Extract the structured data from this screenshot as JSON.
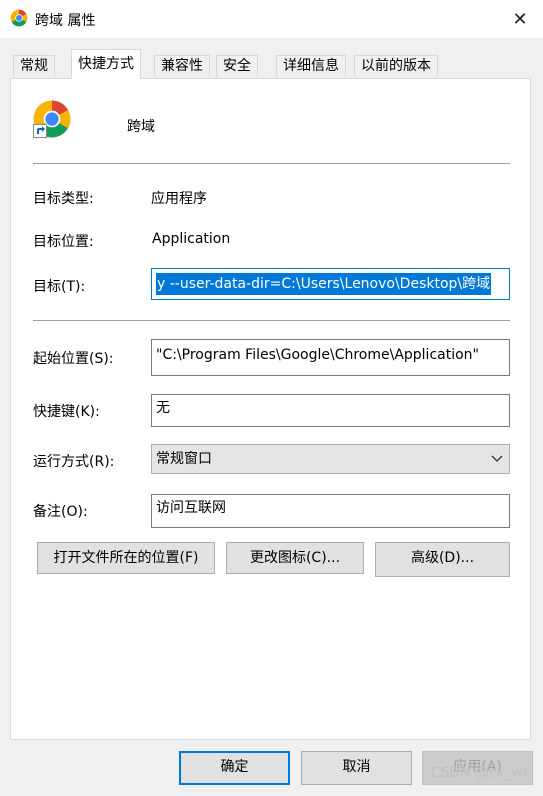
{
  "window": {
    "title": "跨域 属性",
    "close_glyph": "✕"
  },
  "tabs": [
    {
      "label": "常规"
    },
    {
      "label": "快捷方式"
    },
    {
      "label": "兼容性"
    },
    {
      "label": "安全"
    },
    {
      "label": "详细信息"
    },
    {
      "label": "以前的版本"
    }
  ],
  "shortcut": {
    "name": "跨域",
    "target_type_label": "目标类型:",
    "target_type_value": "应用程序",
    "target_location_label": "目标位置:",
    "target_location_value": "Application",
    "target_label": "目标(T):",
    "target_value": "y --user-data-dir=C:\\Users\\Lenovo\\Desktop\\跨域",
    "start_in_label": "起始位置(S):",
    "start_in_value": "\"C:\\Program Files\\Google\\Chrome\\Application\"",
    "hotkey_label": "快捷键(K):",
    "hotkey_value": "无",
    "run_label": "运行方式(R):",
    "run_value": "常规窗口",
    "comment_label": "备注(O):",
    "comment_value": "访问互联网"
  },
  "actions": {
    "open_location": "打开文件所在的位置(F)",
    "change_icon": "更改图标(C)...",
    "advanced": "高级(D)..."
  },
  "footer": {
    "ok": "确定",
    "cancel": "取消",
    "apply": "应用(A)"
  },
  "watermark": "CSDN @ck_wr",
  "colors": {
    "accent": "#0078d7",
    "chrome_red": "#db4437",
    "chrome_yellow": "#f4b400",
    "chrome_green": "#0f9d58",
    "chrome_blue": "#4285f4"
  }
}
